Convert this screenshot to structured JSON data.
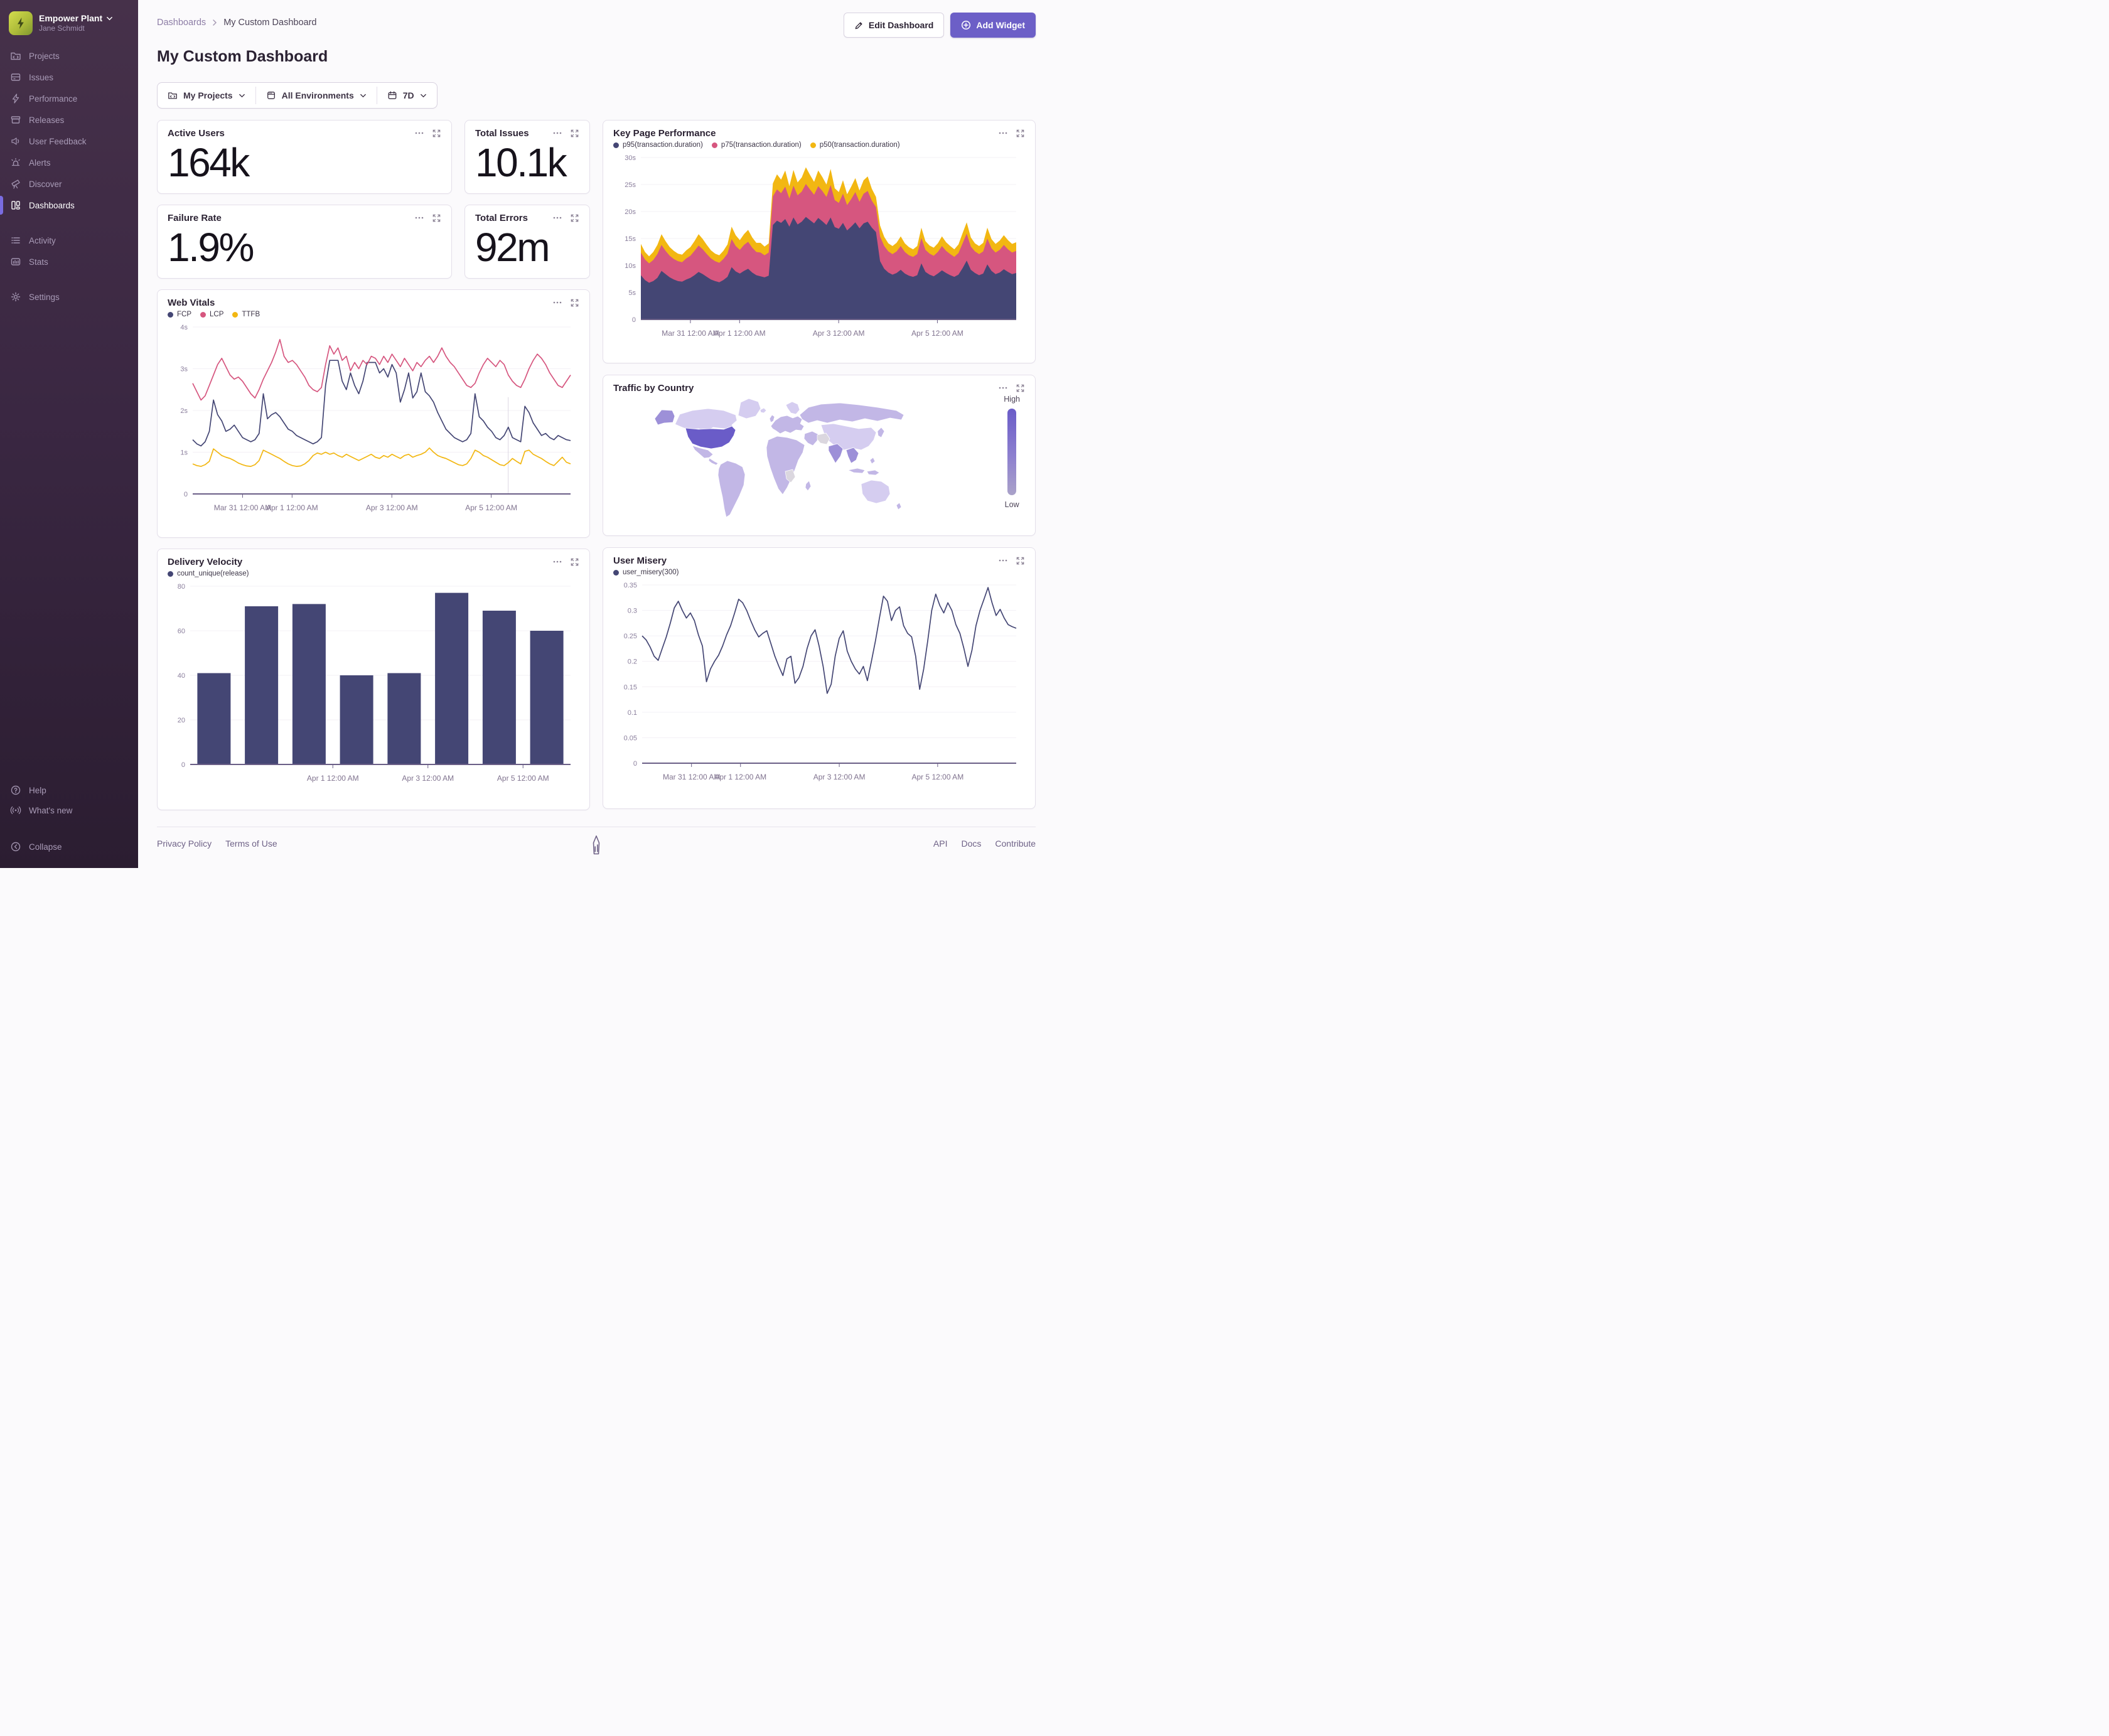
{
  "sidebar": {
    "org": "Empower Plant",
    "user": "Jane Schmidt",
    "items": [
      {
        "label": "Projects"
      },
      {
        "label": "Issues"
      },
      {
        "label": "Performance"
      },
      {
        "label": "Releases"
      },
      {
        "label": "User Feedback"
      },
      {
        "label": "Alerts"
      },
      {
        "label": "Discover"
      },
      {
        "label": "Dashboards",
        "active": true
      },
      {
        "label": "Activity"
      },
      {
        "label": "Stats"
      },
      {
        "label": "Settings"
      }
    ],
    "footer_items": [
      {
        "label": "Help"
      },
      {
        "label": "What's new"
      },
      {
        "label": "Collapse"
      }
    ]
  },
  "header": {
    "breadcrumb_parent": "Dashboards",
    "breadcrumb_current": "My Custom Dashboard",
    "title": "My Custom Dashboard",
    "edit_button": "Edit Dashboard",
    "add_button": "Add Widget"
  },
  "filters": {
    "projects": "My Projects",
    "environments": "All Environments",
    "period": "7D"
  },
  "big_numbers": [
    {
      "title": "Active Users",
      "value": "164k"
    },
    {
      "title": "Total Issues",
      "value": "10.1k"
    },
    {
      "title": "Failure Rate",
      "value": "1.9%"
    },
    {
      "title": "Total Errors",
      "value": "92m"
    }
  ],
  "colors": {
    "accent": "#6C5FC7",
    "series_navy": "#444674",
    "series_pink": "#D6567F",
    "series_yellow": "#F2B712"
  },
  "chart_data": [
    {
      "key": "key_page_performance",
      "type": "area",
      "stacked": true,
      "title": "Key Page Performance",
      "ylim": [
        0,
        30
      ],
      "yticks": [
        {
          "v": 0,
          "label": "0"
        },
        {
          "v": 5,
          "label": "5s"
        },
        {
          "v": 10,
          "label": "10s"
        },
        {
          "v": 15,
          "label": "15s"
        },
        {
          "v": 20,
          "label": "20s"
        },
        {
          "v": 25,
          "label": "25s"
        },
        {
          "v": 30,
          "label": "30s"
        }
      ],
      "xticks": [
        {
          "f": 0.132,
          "label": "Mar 31 12:00 AM"
        },
        {
          "f": 0.263,
          "label": "Apr 1 12:00 AM"
        },
        {
          "f": 0.527,
          "label": "Apr 3 12:00 AM"
        },
        {
          "f": 0.79,
          "label": "Apr 5 12:00 AM"
        }
      ],
      "series": [
        {
          "name": "p95(transaction.duration)",
          "color": "#444674",
          "values": [
            8.2,
            7.3,
            6.8,
            7.1,
            7.7,
            9.0,
            8.4,
            7.8,
            7.4,
            7.1,
            7.0,
            7.4,
            7.7,
            8.2,
            8.8,
            8.4,
            7.9,
            7.4,
            7.1,
            6.9,
            7.3,
            7.9,
            9.7,
            8.9,
            8.5,
            9.0,
            9.4,
            8.7,
            8.2,
            8.0,
            7.8,
            8.1,
            17.5,
            18.3,
            17.9,
            18.6,
            17.2,
            18.9,
            17.6,
            18.1,
            19.0,
            18.4,
            17.8,
            18.8,
            18.2,
            17.5,
            18.9,
            17.1,
            16.8,
            17.9,
            16.5,
            17.2,
            18.0,
            16.9,
            17.8,
            18.1,
            17.0,
            16.2,
            10.8,
            9.4,
            8.7,
            8.3,
            8.6,
            9.2,
            8.5,
            8.1,
            7.9,
            8.2,
            10.4,
            8.8,
            8.3,
            8.0,
            8.5,
            9.1,
            8.6,
            8.2,
            7.9,
            8.3,
            9.5,
            10.9,
            9.2,
            8.6,
            8.2,
            8.5,
            10.2,
            9.0,
            8.4,
            8.7,
            9.3,
            8.8,
            8.4,
            8.6
          ]
        },
        {
          "name": "p75(transaction.duration)",
          "color": "#D6567F",
          "values": [
            4.2,
            3.8,
            3.6,
            3.9,
            4.4,
            4.8,
            4.3,
            4.0,
            3.8,
            3.7,
            3.6,
            3.9,
            4.1,
            4.5,
            4.9,
            4.6,
            4.2,
            3.9,
            3.7,
            3.6,
            3.9,
            4.3,
            5.2,
            4.7,
            4.4,
            4.8,
            5.0,
            4.6,
            4.3,
            4.4,
            4.1,
            4.3,
            5.3,
            5.8,
            5.5,
            6.0,
            5.2,
            5.9,
            5.4,
            5.6,
            6.1,
            5.7,
            5.3,
            5.9,
            5.6,
            5.2,
            6.0,
            5.0,
            4.8,
            5.4,
            4.7,
            5.1,
            5.6,
            4.9,
            5.5,
            5.7,
            5.0,
            4.6,
            4.6,
            4.2,
            3.9,
            3.8,
            4.0,
            4.4,
            4.0,
            3.8,
            3.7,
            3.9,
            4.7,
            4.1,
            3.9,
            3.8,
            4.0,
            4.5,
            4.1,
            3.9,
            3.7,
            4.0,
            4.6,
            5.0,
            4.3,
            4.0,
            3.9,
            4.1,
            4.8,
            4.2,
            4.0,
            4.2,
            4.5,
            4.2,
            4.0,
            4.1
          ]
        },
        {
          "name": "p50(transaction.duration)",
          "color": "#F2B712",
          "values": [
            1.6,
            1.4,
            1.3,
            1.5,
            1.7,
            2.0,
            1.8,
            1.6,
            1.5,
            1.4,
            1.4,
            1.5,
            1.6,
            1.8,
            2.1,
            1.9,
            1.7,
            1.5,
            1.4,
            1.4,
            1.5,
            1.7,
            2.3,
            2.0,
            1.8,
            2.0,
            2.2,
            1.9,
            1.7,
            1.8,
            1.6,
            1.7,
            2.4,
            2.8,
            2.5,
            3.0,
            2.3,
            2.9,
            2.4,
            2.6,
            3.1,
            2.7,
            2.4,
            2.9,
            2.6,
            2.3,
            3.0,
            2.2,
            2.0,
            2.5,
            2.0,
            2.3,
            2.6,
            2.1,
            2.5,
            2.7,
            2.2,
            1.9,
            2.0,
            1.7,
            1.5,
            1.5,
            1.6,
            1.8,
            1.6,
            1.5,
            1.4,
            1.5,
            1.9,
            1.6,
            1.5,
            1.5,
            1.6,
            1.8,
            1.6,
            1.5,
            1.4,
            1.6,
            1.9,
            2.1,
            1.7,
            1.5,
            1.5,
            1.6,
            2.0,
            1.7,
            1.6,
            1.7,
            1.8,
            1.7,
            1.6,
            1.6
          ]
        }
      ]
    },
    {
      "key": "web_vitals",
      "type": "line",
      "title": "Web Vitals",
      "ylim": [
        0,
        4
      ],
      "yticks": [
        {
          "v": 0,
          "label": "0"
        },
        {
          "v": 1,
          "label": "1s"
        },
        {
          "v": 2,
          "label": "2s"
        },
        {
          "v": 3,
          "label": "3s"
        },
        {
          "v": 4,
          "label": "4s"
        }
      ],
      "xticks": [
        {
          "f": 0.132,
          "label": "Mar 31 12:00 AM"
        },
        {
          "f": 0.263,
          "label": "Apr 1 12:00 AM"
        },
        {
          "f": 0.527,
          "label": "Apr 3 12:00 AM"
        },
        {
          "f": 0.79,
          "label": "Apr 5 12:00 AM"
        }
      ],
      "ref_line": {
        "f": 0.835,
        "from_frac": 0.42
      },
      "series": [
        {
          "name": "FCP",
          "color": "#444674",
          "values": [
            1.3,
            1.2,
            1.15,
            1.25,
            1.5,
            2.25,
            1.9,
            1.75,
            1.5,
            1.55,
            1.65,
            1.5,
            1.35,
            1.3,
            1.25,
            1.3,
            1.45,
            2.4,
            1.8,
            1.9,
            1.95,
            1.85,
            1.7,
            1.55,
            1.5,
            1.4,
            1.35,
            1.3,
            1.25,
            1.2,
            1.25,
            1.35,
            2.6,
            3.2,
            3.2,
            3.2,
            2.7,
            2.5,
            2.9,
            2.6,
            2.4,
            2.7,
            3.15,
            3.15,
            3.15,
            2.9,
            3.0,
            2.8,
            3.1,
            2.9,
            2.2,
            2.5,
            2.9,
            2.3,
            2.45,
            2.9,
            2.45,
            2.35,
            2.2,
            1.95,
            1.75,
            1.55,
            1.45,
            1.35,
            1.3,
            1.25,
            1.3,
            1.45,
            2.4,
            1.85,
            1.75,
            1.6,
            1.5,
            1.35,
            1.3,
            1.4,
            1.6,
            1.35,
            1.3,
            1.25,
            2.1,
            1.95,
            1.7,
            1.55,
            1.4,
            1.45,
            1.35,
            1.3,
            1.4,
            1.35,
            1.3,
            1.28
          ]
        },
        {
          "name": "LCP",
          "color": "#D6567F",
          "values": [
            2.65,
            2.45,
            2.25,
            2.35,
            2.6,
            2.85,
            3.1,
            3.25,
            3.05,
            2.85,
            2.75,
            2.8,
            2.7,
            2.55,
            2.4,
            2.3,
            2.5,
            2.75,
            2.95,
            3.15,
            3.4,
            3.7,
            3.3,
            3.15,
            3.2,
            3.1,
            2.95,
            2.8,
            2.6,
            2.5,
            2.45,
            2.55,
            3.1,
            3.55,
            3.35,
            3.5,
            3.2,
            3.3,
            2.95,
            3.15,
            3.0,
            3.2,
            3.1,
            3.3,
            3.25,
            3.1,
            3.3,
            3.15,
            3.35,
            3.2,
            3.05,
            3.25,
            3.1,
            2.95,
            3.15,
            3.05,
            3.2,
            3.3,
            3.15,
            3.3,
            3.5,
            3.3,
            3.15,
            3.05,
            2.9,
            2.75,
            2.6,
            2.55,
            2.65,
            2.9,
            3.1,
            3.25,
            3.15,
            3.05,
            3.2,
            3.1,
            2.85,
            2.7,
            2.6,
            2.55,
            2.75,
            3.0,
            3.2,
            3.35,
            3.25,
            3.1,
            2.9,
            2.75,
            2.6,
            2.55,
            2.7,
            2.85
          ]
        },
        {
          "name": "TTFB",
          "color": "#F2B712",
          "values": [
            0.72,
            0.68,
            0.66,
            0.7,
            0.78,
            1.08,
            1.0,
            0.92,
            0.88,
            0.85,
            0.8,
            0.74,
            0.7,
            0.67,
            0.66,
            0.7,
            0.8,
            1.05,
            1.0,
            0.95,
            0.9,
            0.85,
            0.78,
            0.72,
            0.68,
            0.66,
            0.67,
            0.72,
            0.8,
            0.92,
            0.98,
            0.95,
            1.0,
            0.95,
            0.98,
            0.92,
            0.88,
            0.95,
            0.9,
            0.85,
            0.8,
            0.85,
            0.9,
            0.95,
            0.88,
            0.85,
            0.92,
            0.88,
            0.95,
            0.9,
            0.85,
            0.92,
            0.95,
            0.88,
            0.92,
            0.95,
            1.0,
            1.1,
            1.0,
            0.92,
            0.88,
            0.85,
            0.8,
            0.75,
            0.7,
            0.68,
            0.72,
            0.85,
            1.05,
            1.0,
            0.92,
            0.88,
            0.82,
            0.76,
            0.7,
            0.68,
            0.75,
            0.85,
            0.78,
            0.72,
            1.02,
            1.05,
            0.95,
            0.9,
            0.85,
            0.78,
            0.72,
            0.68,
            0.78,
            0.88,
            0.76,
            0.72
          ]
        }
      ]
    },
    {
      "key": "traffic_by_country",
      "type": "choropleth",
      "title": "Traffic by Country",
      "legend_high": "High",
      "legend_low": "Low",
      "palette": {
        "high": "#6A5CC8",
        "mid": "#9D90D8",
        "base": "#C2B7E6",
        "light": "#D5CDF0",
        "none": "#DBD7DF"
      },
      "regions": {
        "united-states": "high",
        "alaska": "mid",
        "canada": "light",
        "greenland": "light",
        "mexico": "base",
        "central-america": "base",
        "south-america": "base",
        "europe": "base",
        "scandinavia": "light",
        "uk": "base",
        "iceland": "light",
        "russia": "base",
        "central-asia-china": "light",
        "middle-east": "base",
        "iran": "none",
        "india": "mid",
        "se-asia": "mid",
        "indonesia": "base",
        "japan": "base",
        "philippines": "base",
        "africa": "base",
        "drc": "none",
        "madagascar": "base",
        "australia": "light",
        "new-zealand": "base"
      }
    },
    {
      "key": "delivery_velocity",
      "type": "bar",
      "title": "Delivery Velocity",
      "ylim": [
        0,
        80
      ],
      "yticks": [
        {
          "v": 0,
          "label": "0"
        },
        {
          "v": 20,
          "label": "20"
        },
        {
          "v": 40,
          "label": "40"
        },
        {
          "v": 60,
          "label": "60"
        },
        {
          "v": 80,
          "label": "80"
        }
      ],
      "xticks": [
        {
          "f": 0.375,
          "label": "Apr 1 12:00 AM"
        },
        {
          "f": 0.625,
          "label": "Apr 3 12:00 AM"
        },
        {
          "f": 0.875,
          "label": "Apr 5 12:00 AM"
        }
      ],
      "series": [
        {
          "name": "count_unique(release)",
          "color": "#444674",
          "values": [
            41,
            71,
            72,
            40,
            41,
            77,
            69,
            60
          ]
        }
      ]
    },
    {
      "key": "user_misery",
      "type": "line",
      "title": "User Misery",
      "ylim": [
        0,
        0.35
      ],
      "yticks": [
        {
          "v": 0,
          "label": "0"
        },
        {
          "v": 0.05,
          "label": "0.05"
        },
        {
          "v": 0.1,
          "label": "0.1"
        },
        {
          "v": 0.15,
          "label": "0.15"
        },
        {
          "v": 0.2,
          "label": "0.2"
        },
        {
          "v": 0.25,
          "label": "0.25"
        },
        {
          "v": 0.3,
          "label": "0.3"
        },
        {
          "v": 0.35,
          "label": "0.35"
        }
      ],
      "xticks": [
        {
          "f": 0.132,
          "label": "Mar 31 12:00 AM"
        },
        {
          "f": 0.263,
          "label": "Apr 1 12:00 AM"
        },
        {
          "f": 0.527,
          "label": "Apr 3 12:00 AM"
        },
        {
          "f": 0.79,
          "label": "Apr 5 12:00 AM"
        }
      ],
      "series": [
        {
          "name": "user_misery(300)",
          "color": "#444674",
          "values": [
            0.25,
            0.242,
            0.228,
            0.21,
            0.202,
            0.225,
            0.248,
            0.275,
            0.305,
            0.318,
            0.3,
            0.285,
            0.295,
            0.28,
            0.252,
            0.23,
            0.16,
            0.185,
            0.2,
            0.212,
            0.23,
            0.252,
            0.27,
            0.295,
            0.322,
            0.315,
            0.3,
            0.28,
            0.262,
            0.248,
            0.255,
            0.26,
            0.235,
            0.21,
            0.19,
            0.172,
            0.205,
            0.21,
            0.157,
            0.168,
            0.19,
            0.225,
            0.25,
            0.262,
            0.23,
            0.19,
            0.137,
            0.155,
            0.21,
            0.245,
            0.26,
            0.22,
            0.2,
            0.185,
            0.175,
            0.19,
            0.162,
            0.2,
            0.24,
            0.285,
            0.328,
            0.318,
            0.28,
            0.3,
            0.307,
            0.27,
            0.255,
            0.248,
            0.21,
            0.145,
            0.185,
            0.24,
            0.3,
            0.332,
            0.31,
            0.295,
            0.315,
            0.3,
            0.272,
            0.255,
            0.225,
            0.19,
            0.222,
            0.27,
            0.3,
            0.322,
            0.345,
            0.315,
            0.29,
            0.302,
            0.285,
            0.272,
            0.268,
            0.265
          ]
        }
      ]
    }
  ],
  "footer": {
    "links_left": [
      "Privacy Policy",
      "Terms of Use"
    ],
    "links_right": [
      "API",
      "Docs",
      "Contribute"
    ]
  }
}
